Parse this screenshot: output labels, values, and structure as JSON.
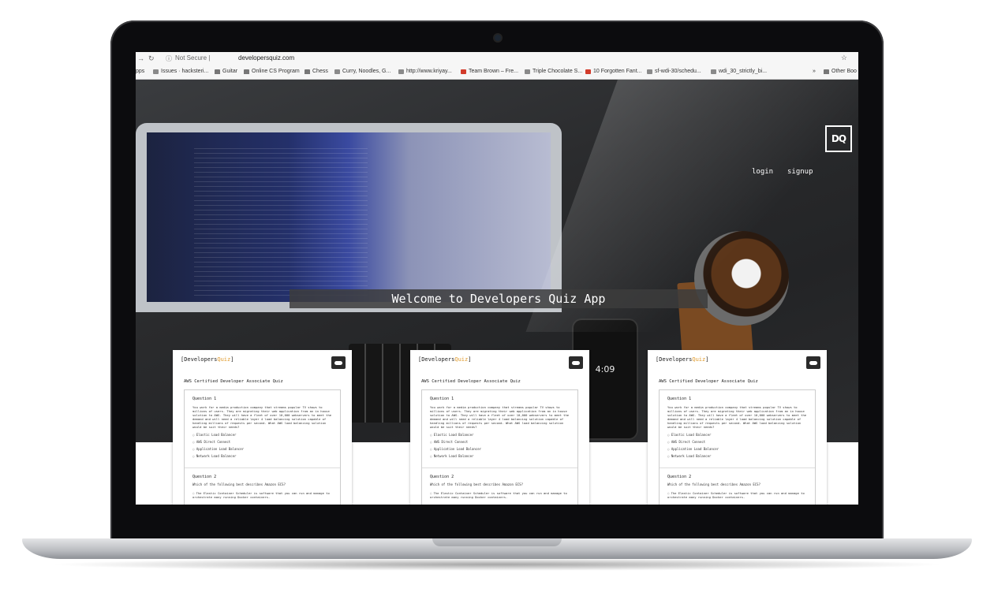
{
  "browser": {
    "security_label": "Not Secure",
    "separator": "|",
    "url": "developersquiz.com",
    "bookmarks": [
      "pps",
      "Issues · hacksteri...",
      "Guitar",
      "Online CS Program",
      "Chess",
      "Curry, Noodles, G...",
      "http://www.kriyay...",
      "Team Brown – Fre...",
      "Triple Chocolate S...",
      "10 Forgotten Fant...",
      "sf-wdi-30/schedu...",
      "wdi_30_strictly_bi...",
      "»",
      "Other Boo"
    ]
  },
  "site": {
    "logo": "DQ",
    "nav": {
      "login": "login",
      "signup": "signup"
    },
    "welcome": "Welcome to Developers Quiz App",
    "phone_time": "4:09"
  },
  "card": {
    "brand_open": "[Developers",
    "brand_quiz": "Quiz",
    "brand_close": "]",
    "title": "AWS Certified Developer Associate Quiz",
    "q1_label": "Question 1",
    "q1_text": "You work for a media production company that streams popular TV shows to millions of users. They are migrating their web application from an in house solution to AWS. They will have a fleet of over 10,000 webservers to meet the demand and will need a reliable layer 4 load balancing solution capable of handling millions of requests per second. What AWS load balancing solution would be suit their needs?",
    "q1_options": [
      "Elastic Load Balancer",
      "AWS Direct Connect",
      "Application Load Balancer",
      "Network Load Balancer"
    ],
    "q2_label": "Question 2",
    "q2_text": "Which of the following best describes Amazon ECS?",
    "q2_option": "The Elastic Container Scheduler is software that you can run and manage to orchestrate many running Docker containers."
  },
  "colors": {
    "accent": "#e09a2b",
    "hero": "#2b2c2e"
  }
}
